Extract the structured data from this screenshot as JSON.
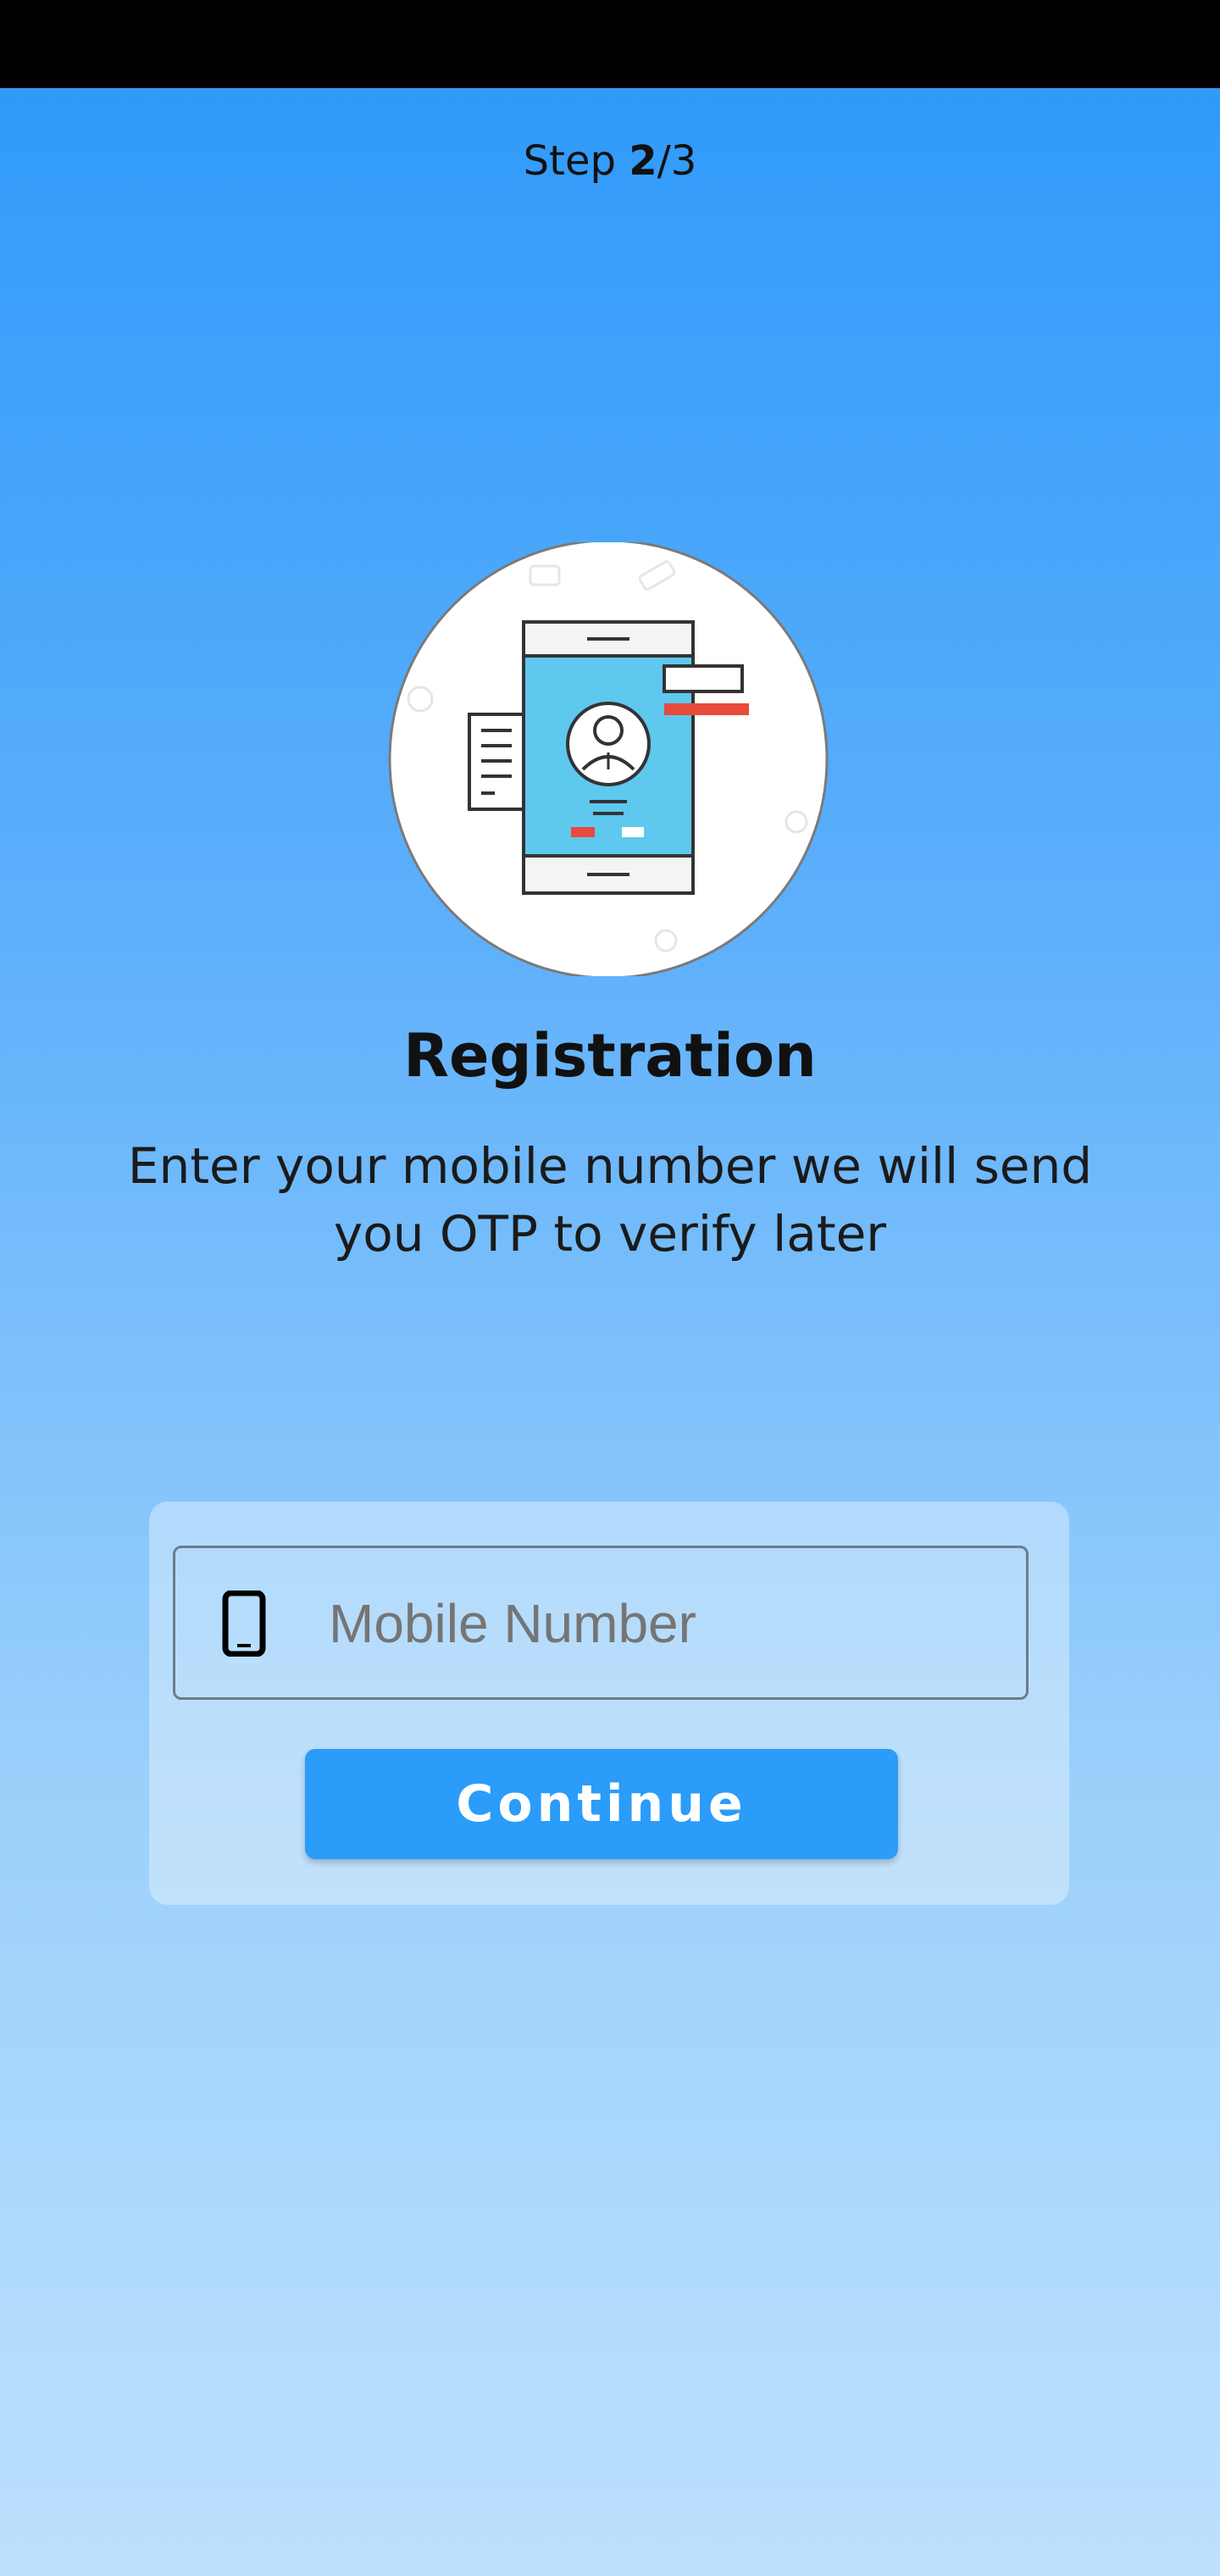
{
  "step": {
    "label": "Step",
    "current": "2",
    "total": "/3"
  },
  "header": {
    "title": "Registration",
    "subtitle": "Enter your mobile number we will send you OTP to verify later"
  },
  "form": {
    "mobile_placeholder": "Mobile Number",
    "mobile_value": "",
    "continue_label": "Continue"
  },
  "colors": {
    "background_top": "#2b98f9",
    "background_bottom": "#bde0fd",
    "button": "#2b9cfa",
    "illustration_screen": "#5ec8ef",
    "illustration_accent": "#e64b3c"
  },
  "icons": {
    "illustration": "phone-profile-illustration",
    "input_icon": "smartphone-icon"
  }
}
